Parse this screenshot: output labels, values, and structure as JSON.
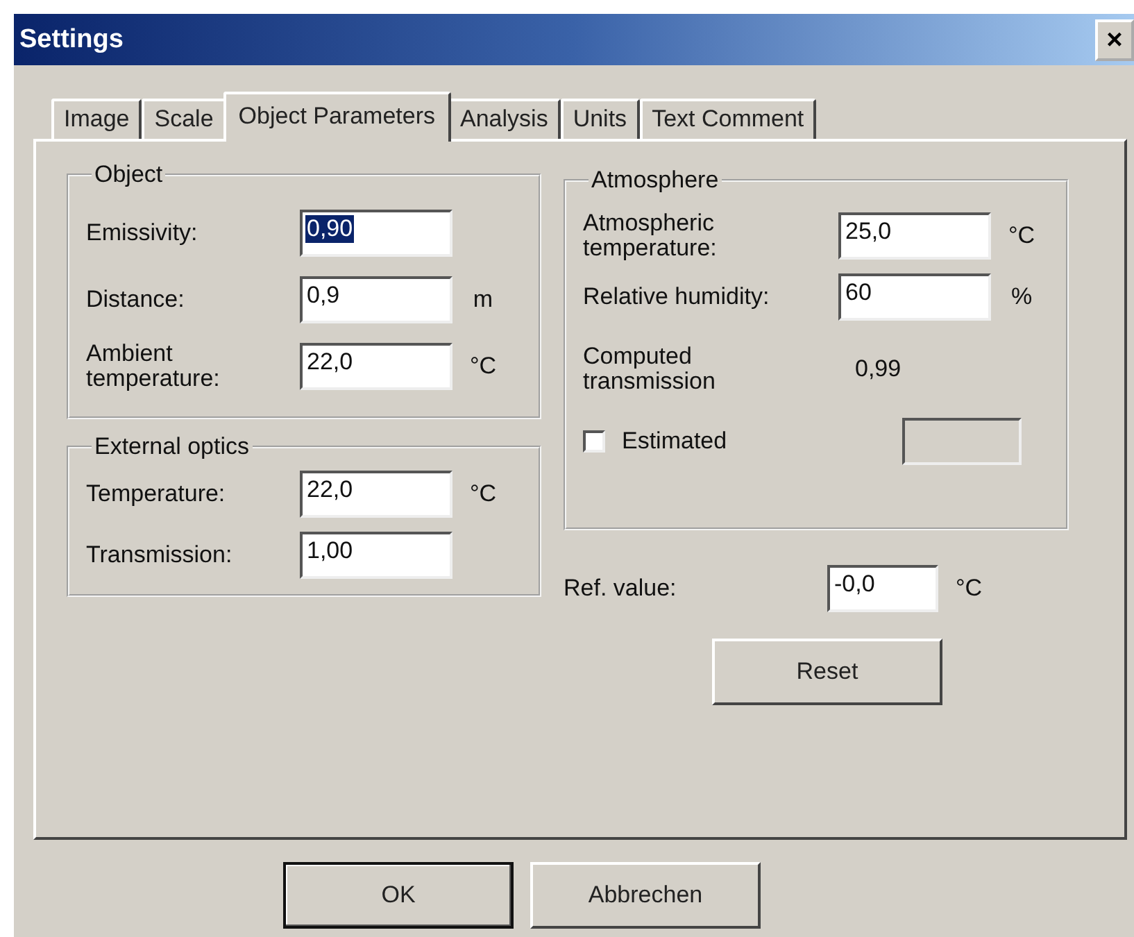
{
  "window": {
    "title": "Settings",
    "close": "×"
  },
  "tabs": [
    {
      "label": "Image",
      "selected": false
    },
    {
      "label": "Scale",
      "selected": false
    },
    {
      "label": "Object Parameters",
      "selected": true
    },
    {
      "label": "Analysis",
      "selected": false
    },
    {
      "label": "Units",
      "selected": false
    },
    {
      "label": "Text Comment",
      "selected": false
    }
  ],
  "object": {
    "title": "Object",
    "fields": [
      {
        "label": "Emissivity:",
        "value": "0,90",
        "text_selected": true
      },
      {
        "label": "Distance:",
        "value": "0,9",
        "unit": "m",
        "text_selected": false
      },
      {
        "label": "Ambient temperature:",
        "value": "22,0",
        "unit": "°C",
        "text_selected": false
      }
    ]
  },
  "external_optics": {
    "title": "External optics",
    "fields": [
      {
        "label": "Temperature:",
        "value": "22,0",
        "unit": "°C",
        "text_selected": false
      },
      {
        "label": "Transmission:",
        "value": "1,00",
        "text_selected": false
      }
    ]
  },
  "atmosphere": {
    "title": "Atmosphere",
    "fields": [
      {
        "label": "Atmospheric temperature:",
        "value": "25,0",
        "unit": "°C",
        "text_selected": false
      },
      {
        "label": "Relative humidity:",
        "value": "60",
        "unit": "%",
        "text_selected": false
      }
    ],
    "computed_label": "Computed transmission",
    "computed_value": "0,99",
    "estimated": {
      "label": "Estimated",
      "checked": false
    },
    "estimate_field": {
      "disabled": true
    }
  },
  "ref_value": {
    "label": "Ref. value:",
    "value": "-0,0",
    "unit": "°C"
  },
  "reset_button": "Reset",
  "buttons": [
    {
      "label": "OK",
      "default": true
    },
    {
      "label": "Abbrechen",
      "default": false
    }
  ]
}
